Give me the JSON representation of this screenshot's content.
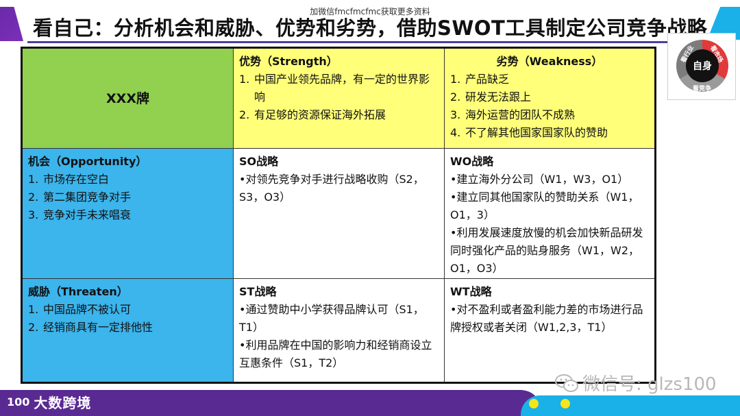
{
  "header": {
    "watermark": "加微信fmcfmcfmc获取更多资料",
    "title": "看自己：分析机会和威胁、优势和劣势，借助SWOT工具制定公司竞争战略"
  },
  "badge": {
    "center": "自身",
    "labels": [
      "看行业",
      "看市场",
      "看竞争"
    ]
  },
  "swot": {
    "corner": "XXX牌",
    "strength": {
      "heading": "优势（Strength）",
      "items": [
        {
          "num": "1.",
          "text": "中国产业领先品牌，有一定的世界影响"
        },
        {
          "num": "2.",
          "text": "有足够的资源保证海外拓展"
        }
      ]
    },
    "weakness": {
      "heading": "劣势（Weakness）",
      "items": [
        {
          "num": "1.",
          "text": "产品缺乏"
        },
        {
          "num": "2.",
          "text": "研发无法跟上"
        },
        {
          "num": "3.",
          "text": "海外运营的团队不成熟"
        },
        {
          "num": "4.",
          "text": "不了解其他国家国家队的赞助"
        }
      ]
    },
    "opportunity": {
      "heading": "机会（Opportunity）",
      "items": [
        {
          "num": "1.",
          "text": "市场存在空白"
        },
        {
          "num": "2.",
          "text": "第二集团竞争对手"
        },
        {
          "num": "3.",
          "text": "竞争对手未来唱衰"
        }
      ]
    },
    "threat": {
      "heading": "威胁（Threaten）",
      "items": [
        {
          "num": "1.",
          "text": "中国品牌不被认可"
        },
        {
          "num": "2.",
          "text": "经销商具有一定排他性"
        }
      ]
    },
    "so": {
      "heading": "SO战略",
      "bullets": [
        "•对领先竞争对手进行战略收购（S2，S3，O3）"
      ]
    },
    "wo": {
      "heading": "WO战略",
      "bullets": [
        "•建立海外分公司（W1，W3，O1）",
        "•建立同其他国家队的赞助关系（W1，O1，3）",
        "•利用发展速度放慢的机会加快新品研发同时强化产品的贴身服务（W1，W2，O1，O3）"
      ]
    },
    "st": {
      "heading": "ST战略",
      "bullets": [
        "•通过赞助中小学获得品牌认可（S1，T1）",
        "•利用品牌在中国的影响力和经销商设立互惠条件（S1，T2）"
      ]
    },
    "wt": {
      "heading": "WT战略",
      "bullets": [
        "•对不盈利或者盈利能力差的市场进行品牌授权或者关闭（W1,2,3，T1）"
      ]
    }
  },
  "footer": {
    "logo_mark": "100",
    "logo_text": "大数跨境",
    "wechat": "微信号: glzs100"
  },
  "colors": {
    "green": "#92d050",
    "yellow": "#ffff7a",
    "blue": "#3cb4ec",
    "purple": "#5a2a93",
    "cyan": "#1ab0e8"
  }
}
